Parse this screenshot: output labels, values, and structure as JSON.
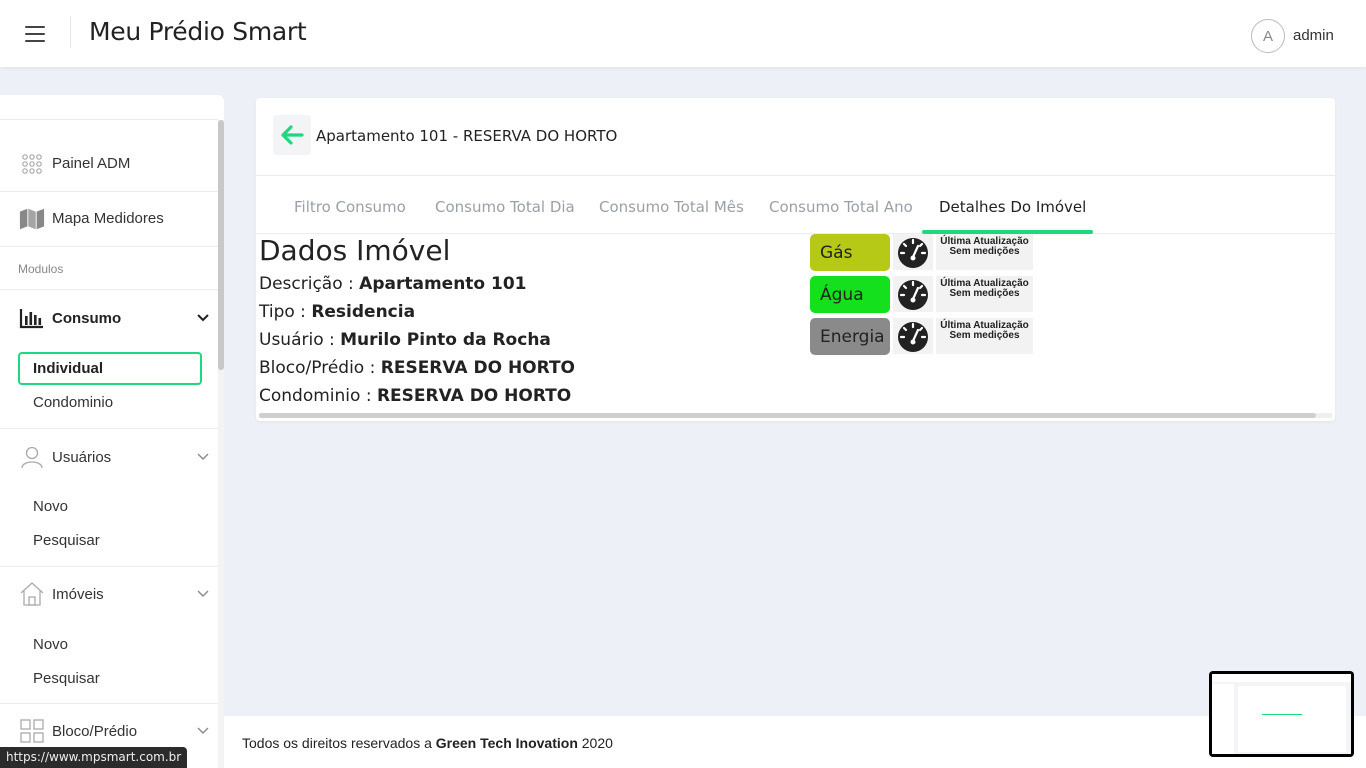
{
  "header": {
    "app_title": "Meu Prédio Smart",
    "user_initial": "A",
    "user_name": "admin"
  },
  "sidebar": {
    "items": [
      {
        "label": "Painel ADM",
        "icon": "grid-dots-icon"
      },
      {
        "label": "Mapa Medidores",
        "icon": "map-icon"
      }
    ],
    "section_label": "Modulos",
    "consumo": {
      "label": "Consumo",
      "icon": "bar-chart-icon",
      "sub": [
        {
          "label": "Individual",
          "active": true
        },
        {
          "label": "Condominio",
          "active": false
        }
      ]
    },
    "usuarios": {
      "label": "Usuários",
      "icon": "user-icon",
      "sub": [
        {
          "label": "Novo"
        },
        {
          "label": "Pesquisar"
        }
      ]
    },
    "imoveis": {
      "label": "Imóveis",
      "icon": "house-icon",
      "sub": [
        {
          "label": "Novo"
        },
        {
          "label": "Pesquisar"
        }
      ]
    },
    "bloco": {
      "label": "Bloco/Prédio",
      "icon": "building-grid-icon"
    }
  },
  "card": {
    "title": "Apartamento 101 - RESERVA DO HORTO",
    "tabs": [
      {
        "label": "Filtro Consumo",
        "active": false
      },
      {
        "label": "Consumo Total Dia",
        "active": false
      },
      {
        "label": "Consumo Total Mês",
        "active": false
      },
      {
        "label": "Consumo Total Ano",
        "active": false
      },
      {
        "label": "Detalhes Do Imóvel",
        "active": true
      }
    ],
    "dados_title": "Dados Imóvel",
    "fields": [
      {
        "label": "Descrição : ",
        "value": "Apartamento 101"
      },
      {
        "label": "Tipo : ",
        "value": "Residencia"
      },
      {
        "label": "Usuário : ",
        "value": "Murilo Pinto da Rocha"
      },
      {
        "label": "Bloco/Prédio : ",
        "value": "RESERVA DO HORTO"
      },
      {
        "label": "Condominio : ",
        "value": "RESERVA DO HORTO"
      }
    ],
    "utilities": [
      {
        "label": "Gás",
        "color": "#b5c916",
        "status_line1": "Última Atualização",
        "status_line2": "Sem medições"
      },
      {
        "label": "Água",
        "color": "#14e01d",
        "status_line1": "Última Atualização",
        "status_line2": "Sem medições"
      },
      {
        "label": "Energia",
        "color": "#8a8a8a",
        "status_line1": "Última Atualização",
        "status_line2": "Sem medições"
      }
    ]
  },
  "footer": {
    "text_prefix": "Todos os direitos reservados a ",
    "company": "Green Tech Inovation",
    "year": " 2020"
  },
  "status_bar_url": "https://www.mpsmart.com.br",
  "colors": {
    "accent": "#1ed87f",
    "background": "#eef0f8"
  }
}
